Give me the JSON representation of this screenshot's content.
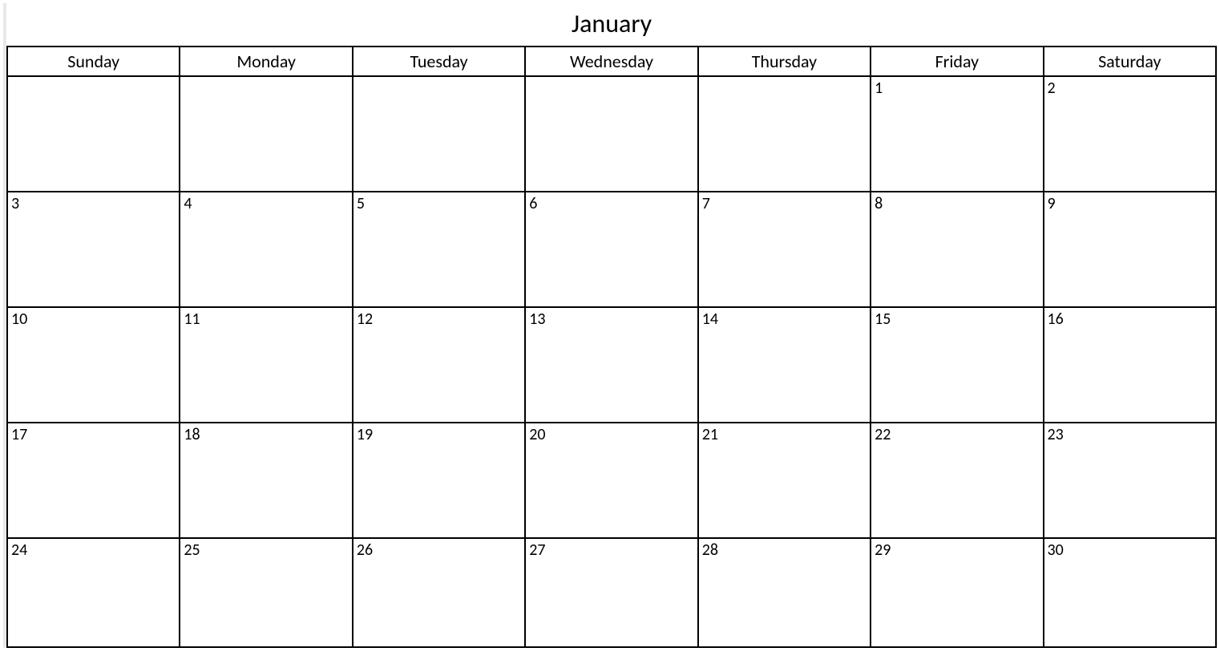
{
  "calendar": {
    "month_title": "January",
    "day_headers": [
      "Sunday",
      "Monday",
      "Tuesday",
      "Wednesday",
      "Thursday",
      "Friday",
      "Saturday"
    ],
    "weeks": [
      [
        "",
        "",
        "",
        "",
        "",
        "1",
        "2"
      ],
      [
        "3",
        "4",
        "5",
        "6",
        "7",
        "8",
        "9"
      ],
      [
        "10",
        "11",
        "12",
        "13",
        "14",
        "15",
        "16"
      ],
      [
        "17",
        "18",
        "19",
        "20",
        "21",
        "22",
        "23"
      ],
      [
        "24",
        "25",
        "26",
        "27",
        "28",
        "29",
        "30"
      ]
    ]
  }
}
